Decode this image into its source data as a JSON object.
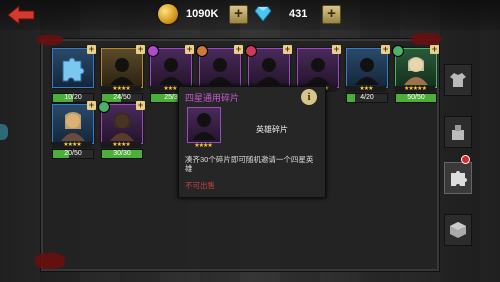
{
  "currency": {
    "coins": "1090K",
    "gems": "431"
  },
  "cards": [
    {
      "id": "puzzle",
      "frame": "blue",
      "progress": "10/20",
      "stars": "",
      "ratio": 0.5
    },
    {
      "id": "h1",
      "frame": "gold",
      "progress": "24/50",
      "stars": "★★★★",
      "ratio": 0.48
    },
    {
      "id": "h2",
      "frame": "purple",
      "progress": "25/3",
      "stars": "★★★",
      "ratio": 0.8
    },
    {
      "id": "h3",
      "frame": "purple",
      "progress": "",
      "stars": "★★★★★",
      "ratio": 0
    },
    {
      "id": "h4",
      "frame": "purple",
      "progress": "",
      "stars": "★★★★★",
      "ratio": 0
    },
    {
      "id": "h5",
      "frame": "purple",
      "progress": "",
      "stars": "★★★★★",
      "ratio": 0
    },
    {
      "id": "h6",
      "frame": "blue",
      "progress": "4/20",
      "stars": "★★★",
      "ratio": 0.2
    },
    {
      "id": "h7",
      "frame": "green",
      "progress": "50/50",
      "stars": "★★★★★",
      "ratio": 1
    },
    {
      "id": "h8",
      "frame": "blue",
      "progress": "20/50",
      "stars": "★★★★",
      "ratio": 0.4
    },
    {
      "id": "h9",
      "frame": "purple",
      "progress": "30/30",
      "stars": "★★★★",
      "ratio": 1
    }
  ],
  "popup": {
    "title": "四星通用碎片",
    "info": "i",
    "stars": "★★★★",
    "name": "英雄碎片",
    "description": "凑齐30个碎片即可随机邀请一个四星英雄",
    "not_sellable": "不可出售"
  },
  "colors": {
    "accent_green": "#4caf3a",
    "title_purple": "#c95ad6",
    "warning_red": "#c94040"
  }
}
